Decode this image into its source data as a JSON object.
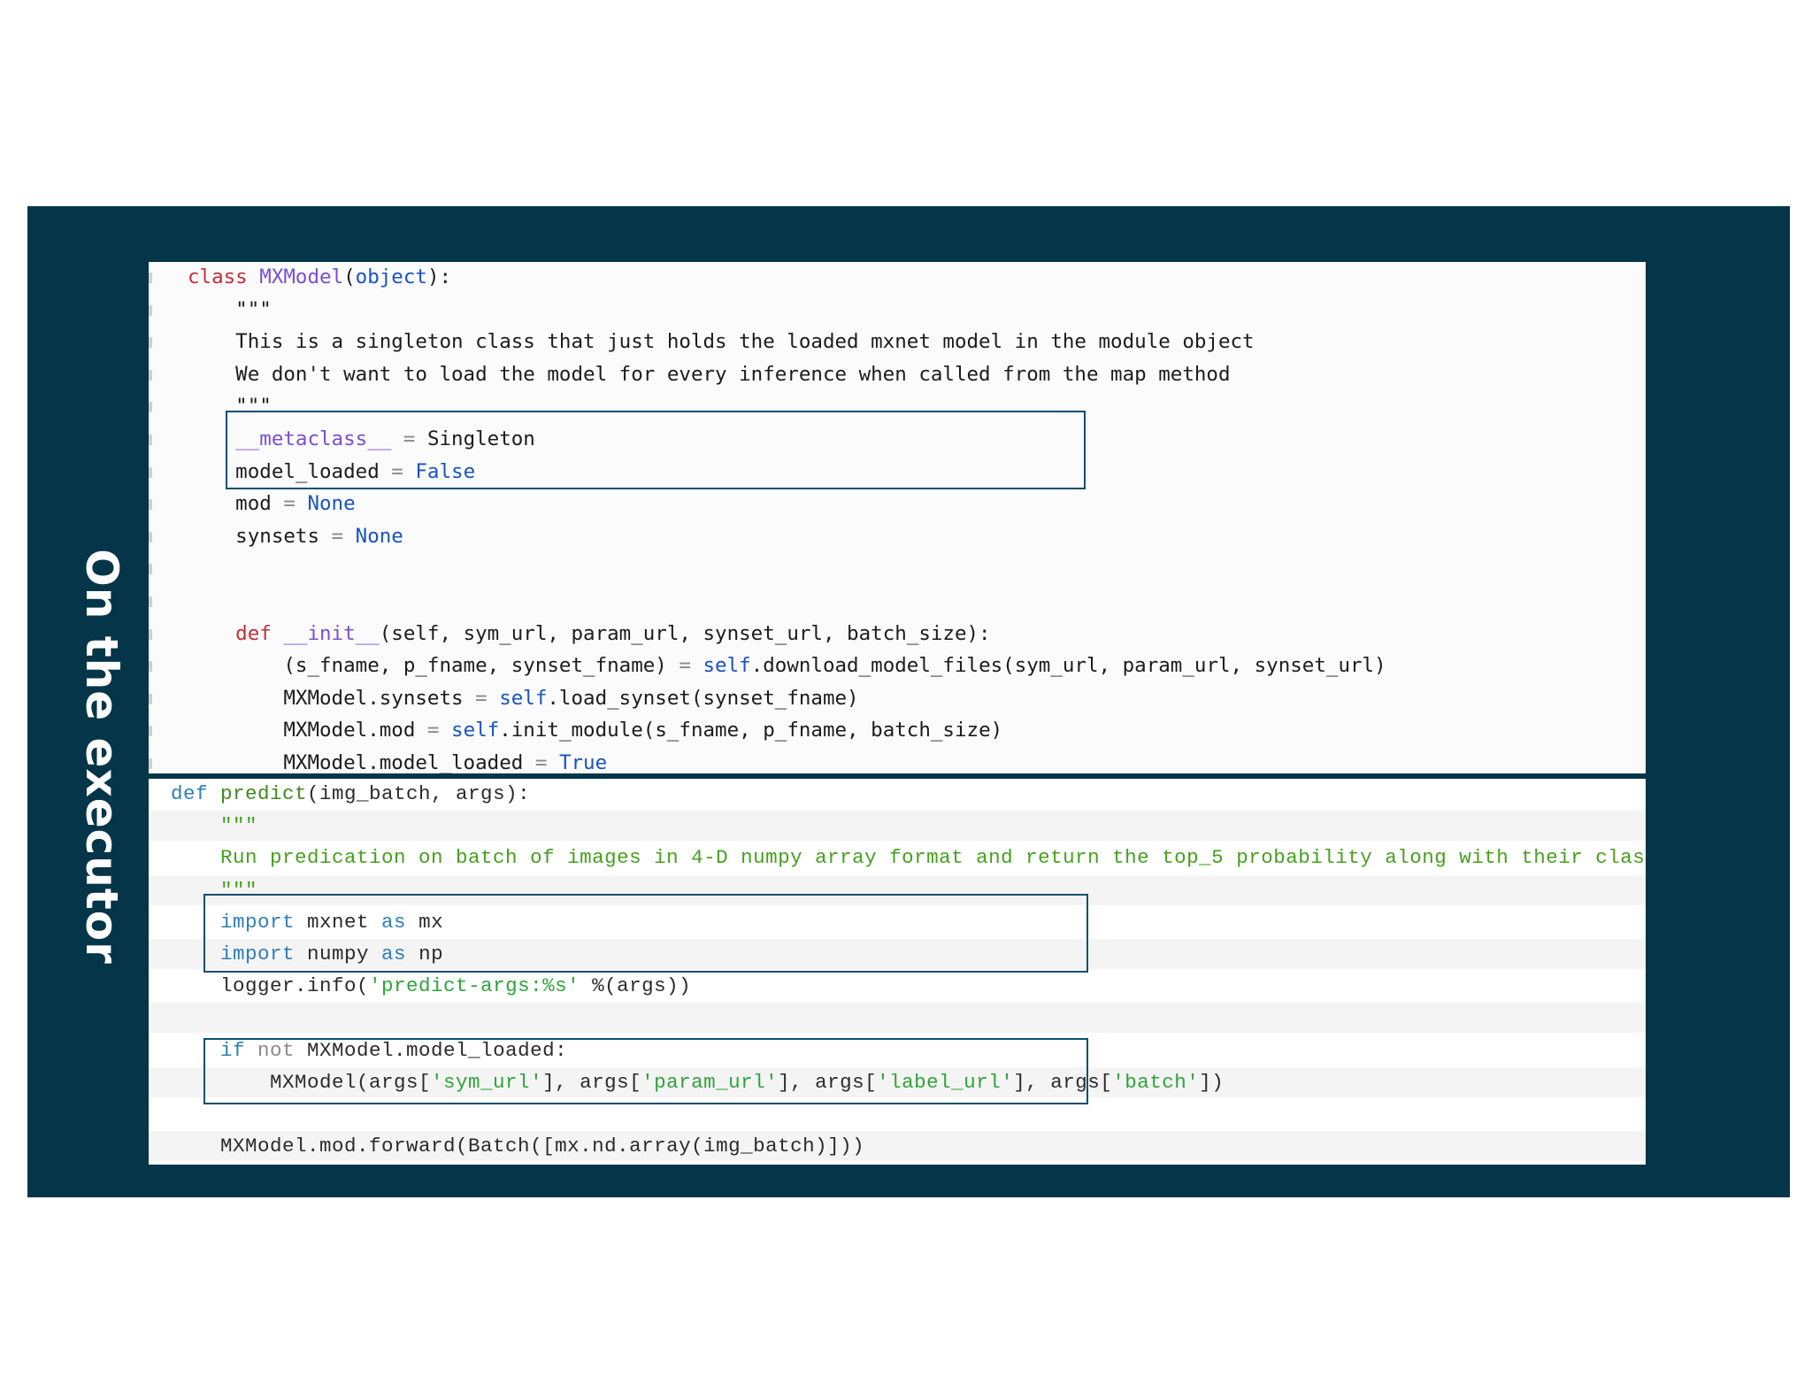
{
  "slide_title": "On the executor",
  "code_block_1": {
    "lines": [
      {
        "parts": [
          {
            "t": "class ",
            "c": "kw-red"
          },
          {
            "t": "MXModel",
            "c": "kw-purple"
          },
          {
            "t": "(",
            "c": ""
          },
          {
            "t": "object",
            "c": "kw-blue"
          },
          {
            "t": "):",
            "c": ""
          }
        ]
      },
      {
        "parts": [
          {
            "t": "    \"\"\"",
            "c": ""
          }
        ]
      },
      {
        "parts": [
          {
            "t": "    This is a singleton class that just holds the loaded mxnet model in the module object",
            "c": ""
          }
        ]
      },
      {
        "parts": [
          {
            "t": "    We don't want to load the model for every inference when called from the map method",
            "c": ""
          }
        ]
      },
      {
        "parts": [
          {
            "t": "    \"\"\"",
            "c": ""
          }
        ]
      },
      {
        "parts": [
          {
            "t": "    __metaclass__",
            "c": "kw-purple"
          },
          {
            "t": " = ",
            "c": "op-muted"
          },
          {
            "t": "Singleton",
            "c": ""
          }
        ]
      },
      {
        "parts": [
          {
            "t": "    model_loaded",
            "c": ""
          },
          {
            "t": " = ",
            "c": "op-muted"
          },
          {
            "t": "False",
            "c": "kw-blue"
          }
        ]
      },
      {
        "parts": [
          {
            "t": "    mod",
            "c": ""
          },
          {
            "t": " = ",
            "c": "op-muted"
          },
          {
            "t": "None",
            "c": "kw-blue"
          }
        ]
      },
      {
        "parts": [
          {
            "t": "    synsets",
            "c": ""
          },
          {
            "t": " = ",
            "c": "op-muted"
          },
          {
            "t": "None",
            "c": "kw-blue"
          }
        ]
      },
      {
        "parts": []
      },
      {
        "parts": []
      },
      {
        "parts": [
          {
            "t": "    def ",
            "c": "kw-red"
          },
          {
            "t": "__init__",
            "c": "kw-purple"
          },
          {
            "t": "(self, sym_url, param_url, synset_url, batch_size):",
            "c": ""
          }
        ]
      },
      {
        "parts": [
          {
            "t": "        (s_fname, p_fname, synset_fname)",
            "c": ""
          },
          {
            "t": " = ",
            "c": "op-muted"
          },
          {
            "t": "self",
            "c": "kw-blue"
          },
          {
            "t": ".download_model_files(sym_url, param_url, synset_url)",
            "c": ""
          }
        ]
      },
      {
        "parts": [
          {
            "t": "        MXModel.synsets",
            "c": ""
          },
          {
            "t": " = ",
            "c": "op-muted"
          },
          {
            "t": "self",
            "c": "kw-blue"
          },
          {
            "t": ".load_synset(synset_fname)",
            "c": ""
          }
        ]
      },
      {
        "parts": [
          {
            "t": "        MXModel.mod",
            "c": ""
          },
          {
            "t": " = ",
            "c": "op-muted"
          },
          {
            "t": "self",
            "c": "kw-blue"
          },
          {
            "t": ".init_module(s_fname, p_fname, batch_size)",
            "c": ""
          }
        ]
      },
      {
        "parts": [
          {
            "t": "        MXModel.model_loaded",
            "c": ""
          },
          {
            "t": " = ",
            "c": "op-muted"
          },
          {
            "t": "True",
            "c": "kw-blue"
          }
        ]
      }
    ]
  },
  "code_block_2": {
    "lines": [
      {
        "parts": [
          {
            "t": "def ",
            "c": "kw-teal"
          },
          {
            "t": "predict",
            "c": "func-green"
          },
          {
            "t": "(img_batch, args):",
            "c": ""
          }
        ]
      },
      {
        "parts": [
          {
            "t": "    \"\"\"",
            "c": "doc-green"
          }
        ]
      },
      {
        "parts": [
          {
            "t": "    Run predication on batch of images in 4-D numpy array format and return the top_5 probability along with their classes",
            "c": "doc-green"
          }
        ]
      },
      {
        "parts": [
          {
            "t": "    \"\"\"",
            "c": "doc-green"
          }
        ]
      },
      {
        "parts": [
          {
            "t": "    import",
            "c": "kw-teal"
          },
          {
            "t": " mxnet ",
            "c": ""
          },
          {
            "t": "as",
            "c": "kw-teal"
          },
          {
            "t": " mx",
            "c": ""
          }
        ]
      },
      {
        "parts": [
          {
            "t": "    import",
            "c": "kw-teal"
          },
          {
            "t": " numpy ",
            "c": ""
          },
          {
            "t": "as",
            "c": "kw-teal"
          },
          {
            "t": " np",
            "c": ""
          }
        ]
      },
      {
        "parts": [
          {
            "t": "    logger.info(",
            "c": ""
          },
          {
            "t": "'predict-args:%s'",
            "c": "str-green"
          },
          {
            "t": " %(args))",
            "c": ""
          }
        ]
      },
      {
        "parts": []
      },
      {
        "parts": [
          {
            "t": "    if",
            "c": "kw-teal"
          },
          {
            "t": " not",
            "c": "op-muted"
          },
          {
            "t": " MXModel.model_loaded:",
            "c": ""
          }
        ]
      },
      {
        "parts": [
          {
            "t": "        MXModel(args[",
            "c": ""
          },
          {
            "t": "'sym_url'",
            "c": "str-green"
          },
          {
            "t": "], args[",
            "c": ""
          },
          {
            "t": "'param_url'",
            "c": "str-green"
          },
          {
            "t": "], args[",
            "c": ""
          },
          {
            "t": "'label_url'",
            "c": "str-green"
          },
          {
            "t": "], args[",
            "c": ""
          },
          {
            "t": "'batch'",
            "c": "str-green"
          },
          {
            "t": "])",
            "c": ""
          }
        ]
      },
      {
        "parts": []
      },
      {
        "parts": [
          {
            "t": "    MXModel.mod.forward(Batch([mx.nd.array(img_batch)]))",
            "c": ""
          }
        ]
      }
    ]
  }
}
